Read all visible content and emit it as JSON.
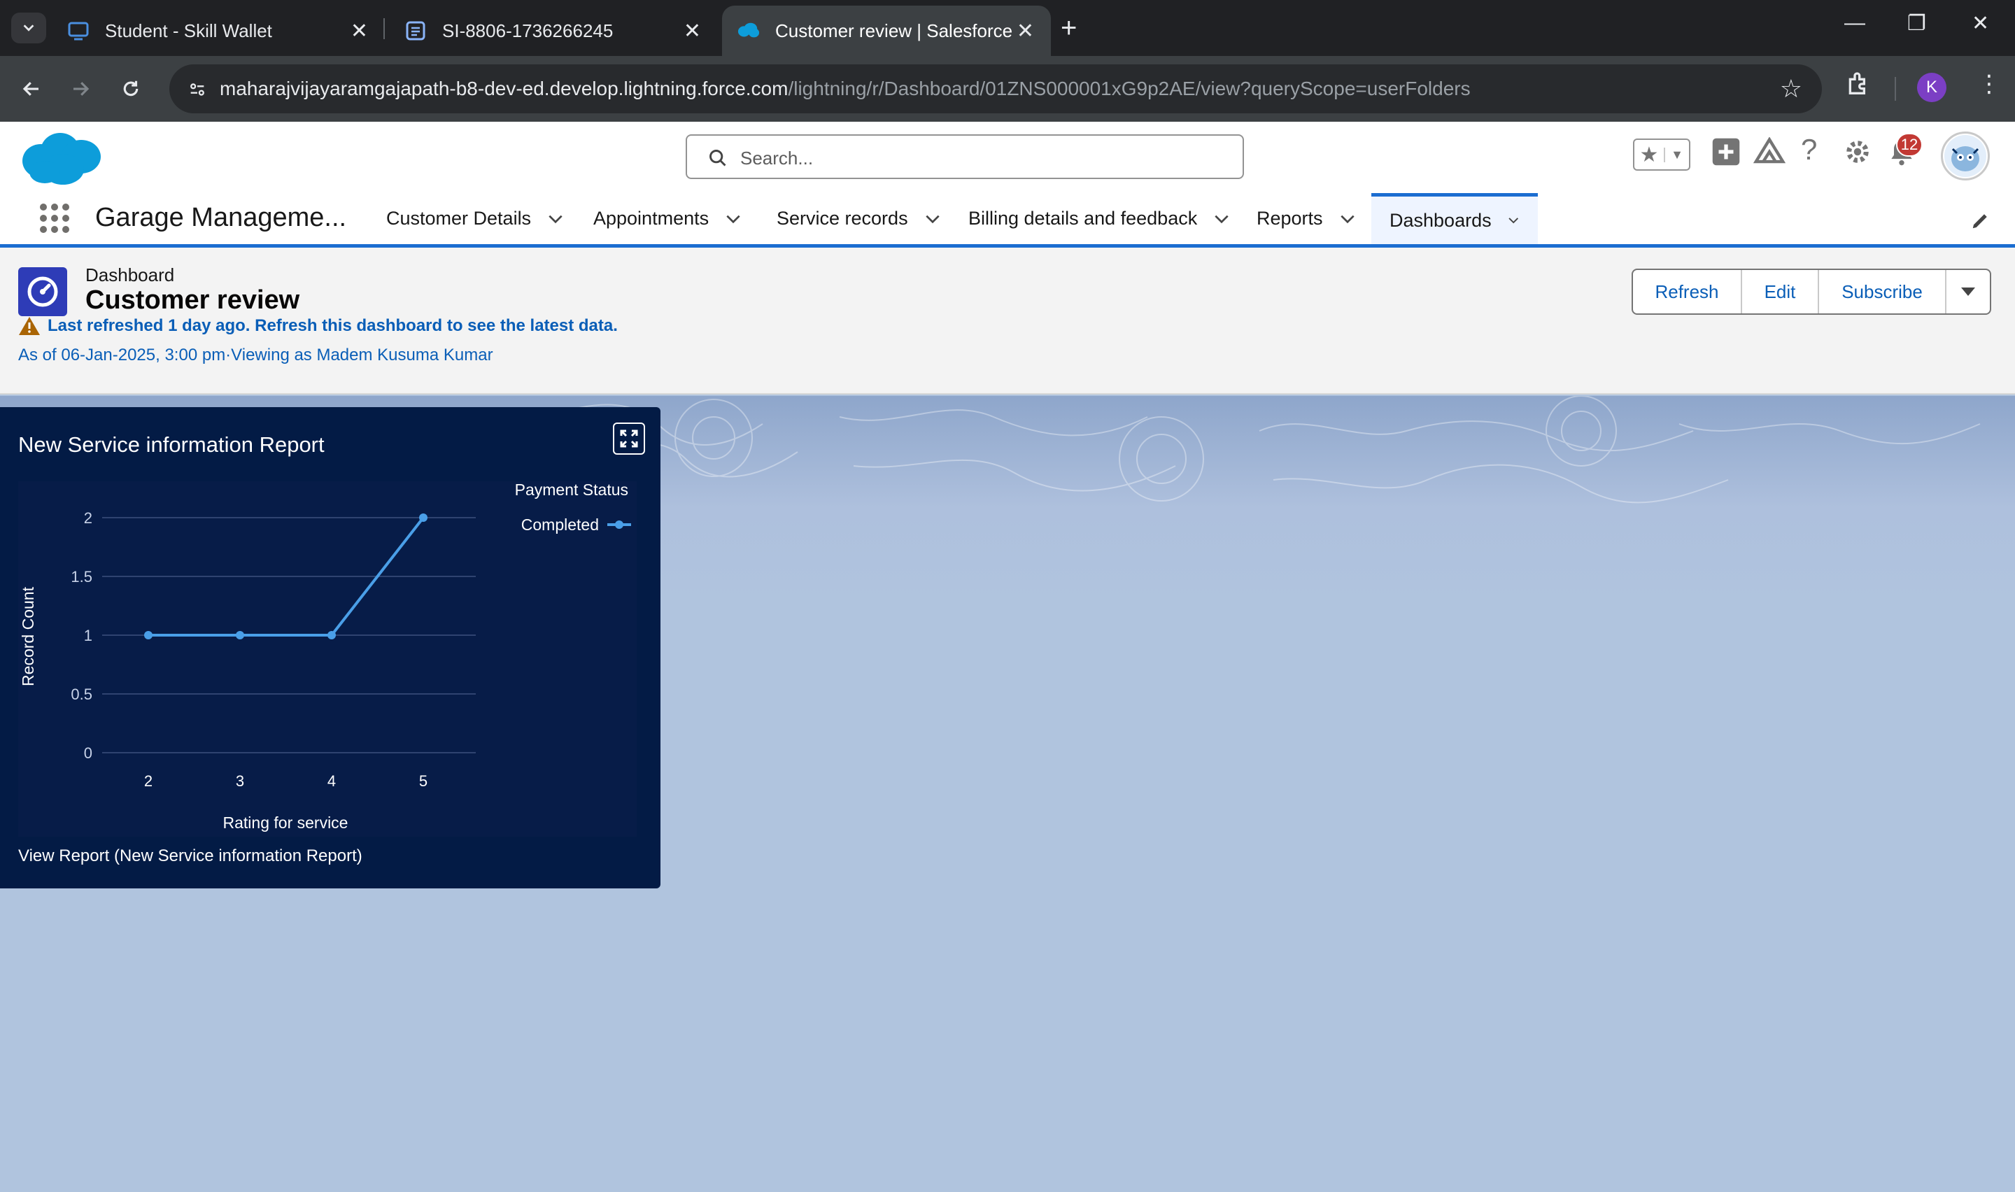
{
  "browser": {
    "tabs": [
      {
        "title": "Student - Skill Wallet",
        "active": false
      },
      {
        "title": "SI-8806-1736266245",
        "active": false
      },
      {
        "title": "Customer review | Salesforce",
        "active": true
      }
    ],
    "url_domain": "maharajvijayaramgajapath-b8-dev-ed.develop.lightning.force.com",
    "url_path": "/lightning/r/Dashboard/01ZNS000001xG9p2AE/view?queryScope=userFolders",
    "profile_initial": "K"
  },
  "header": {
    "search_placeholder": "Search...",
    "notification_count": "12"
  },
  "nav": {
    "app_name": "Garage Manageme...",
    "items": [
      {
        "label": "Customer Details"
      },
      {
        "label": "Appointments"
      },
      {
        "label": "Service records"
      },
      {
        "label": "Billing details and feedback"
      },
      {
        "label": "Reports"
      },
      {
        "label": "Dashboards",
        "active": true
      }
    ]
  },
  "dashboard": {
    "type_label": "Dashboard",
    "title": "Customer review",
    "warning": "Last refreshed 1 day ago. Refresh this dashboard to see the latest data.",
    "as_of": "As of 06-Jan-2025, 3:00 pm·Viewing as Madem Kusuma Kumar",
    "buttons": {
      "refresh": "Refresh",
      "edit": "Edit",
      "subscribe": "Subscribe"
    }
  },
  "widget": {
    "title": "New Service information Report",
    "view_report": "View Report (New Service information Report)"
  },
  "chart_data": {
    "type": "line",
    "x": [
      "2",
      "3",
      "4",
      "5"
    ],
    "series": [
      {
        "name": "Completed",
        "values": [
          1,
          1,
          1,
          2
        ],
        "color": "#4a9fe8"
      }
    ],
    "xlabel": "Rating for service",
    "ylabel": "Record Count",
    "legend_title": "Payment Status",
    "legend_position": "top-right",
    "y_ticks": [
      "0",
      "0.5",
      "1",
      "1.5",
      "2"
    ],
    "ylim": [
      0,
      2
    ],
    "grid": true
  }
}
